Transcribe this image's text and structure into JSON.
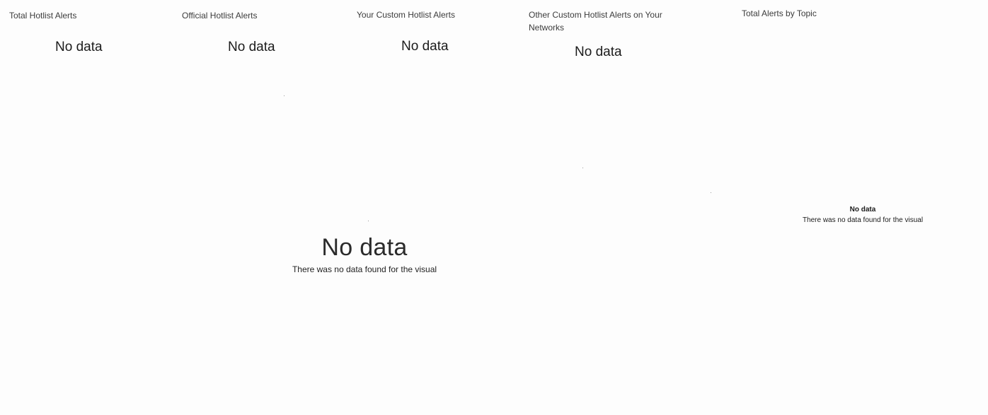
{
  "kpis": [
    {
      "title": "Total Hotlist Alerts",
      "value": "No data"
    },
    {
      "title": "Official Hotlist Alerts",
      "value": "No data"
    },
    {
      "title": "Your Custom Hotlist Alerts",
      "value": "No data"
    },
    {
      "title": "Other Custom Hotlist Alerts on Your Networks",
      "value": "No data"
    }
  ],
  "topic_chart": {
    "title": "Total Alerts by Topic",
    "empty_title": "No data",
    "empty_message": "There was no data found for the visual"
  },
  "main_visual": {
    "empty_title": "No data",
    "empty_message": "There was no data found for the visual"
  }
}
